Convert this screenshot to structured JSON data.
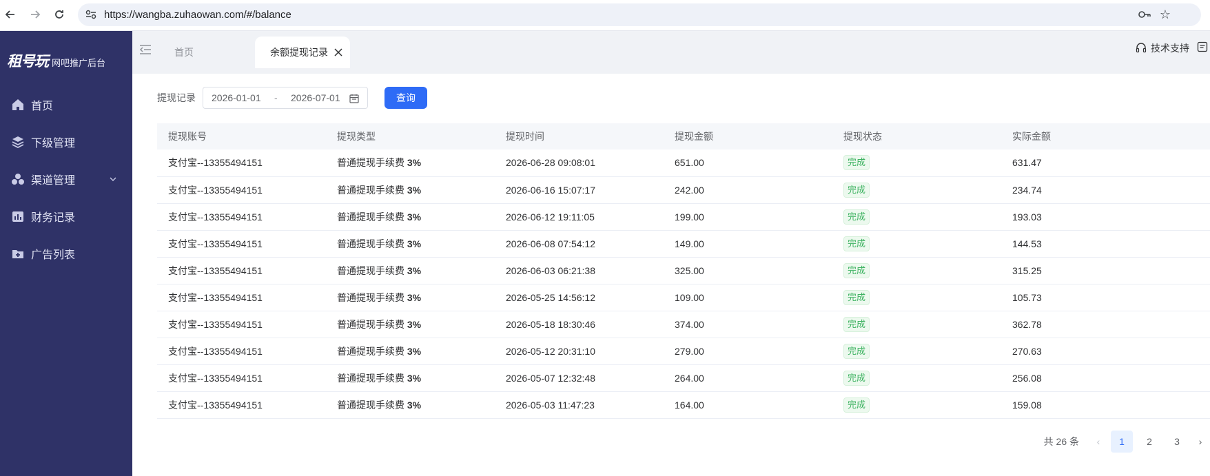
{
  "browser": {
    "url": "https://wangba.zuhaowan.com/#/balance"
  },
  "sidebar": {
    "logo": "租号玩",
    "subtitle": "网吧推广后台",
    "items": [
      {
        "label": "首页",
        "icon": "home-icon"
      },
      {
        "label": "下级管理",
        "icon": "layers-icon"
      },
      {
        "label": "渠道管理",
        "icon": "channels-icon"
      },
      {
        "label": "财务记录",
        "icon": "finance-icon"
      },
      {
        "label": "广告列表",
        "icon": "ad-folder-icon"
      }
    ]
  },
  "tabs": {
    "home": "首页",
    "active": "余额提现记录"
  },
  "header": {
    "support": "技术支持"
  },
  "filter": {
    "label": "提现记录",
    "start_date": "2026-01-01",
    "separator": "-",
    "end_date": "2026-07-01",
    "query_button": "查询"
  },
  "table": {
    "columns": [
      "提现账号",
      "提现类型",
      "提现时间",
      "提现金额",
      "提现状态",
      "实际金额"
    ],
    "rows": [
      {
        "account": "支付宝--13355494151",
        "type": "普通提现手续费",
        "fee": "3%",
        "time": "2026-06-28 09:08:01",
        "amount": "651.00",
        "status": "完成",
        "actual": "631.47"
      },
      {
        "account": "支付宝--13355494151",
        "type": "普通提现手续费",
        "fee": "3%",
        "time": "2026-06-16 15:07:17",
        "amount": "242.00",
        "status": "完成",
        "actual": "234.74"
      },
      {
        "account": "支付宝--13355494151",
        "type": "普通提现手续费",
        "fee": "3%",
        "time": "2026-06-12 19:11:05",
        "amount": "199.00",
        "status": "完成",
        "actual": "193.03"
      },
      {
        "account": "支付宝--13355494151",
        "type": "普通提现手续费",
        "fee": "3%",
        "time": "2026-06-08 07:54:12",
        "amount": "149.00",
        "status": "完成",
        "actual": "144.53"
      },
      {
        "account": "支付宝--13355494151",
        "type": "普通提现手续费",
        "fee": "3%",
        "time": "2026-06-03 06:21:38",
        "amount": "325.00",
        "status": "完成",
        "actual": "315.25"
      },
      {
        "account": "支付宝--13355494151",
        "type": "普通提现手续费",
        "fee": "3%",
        "time": "2026-05-25 14:56:12",
        "amount": "109.00",
        "status": "完成",
        "actual": "105.73"
      },
      {
        "account": "支付宝--13355494151",
        "type": "普通提现手续费",
        "fee": "3%",
        "time": "2026-05-18 18:30:46",
        "amount": "374.00",
        "status": "完成",
        "actual": "362.78"
      },
      {
        "account": "支付宝--13355494151",
        "type": "普通提现手续费",
        "fee": "3%",
        "time": "2026-05-12 20:31:10",
        "amount": "279.00",
        "status": "完成",
        "actual": "270.63"
      },
      {
        "account": "支付宝--13355494151",
        "type": "普通提现手续费",
        "fee": "3%",
        "time": "2026-05-07 12:32:48",
        "amount": "264.00",
        "status": "完成",
        "actual": "256.08"
      },
      {
        "account": "支付宝--13355494151",
        "type": "普通提现手续费",
        "fee": "3%",
        "time": "2026-05-03 11:47:23",
        "amount": "164.00",
        "status": "完成",
        "actual": "159.08"
      }
    ]
  },
  "pagination": {
    "total": "共 26 条",
    "pages": [
      "1",
      "2",
      "3"
    ],
    "current": "1"
  },
  "colors": {
    "sidebar_bg": "#2f3267",
    "primary": "#2e6bf6",
    "success": "#3fb362"
  }
}
